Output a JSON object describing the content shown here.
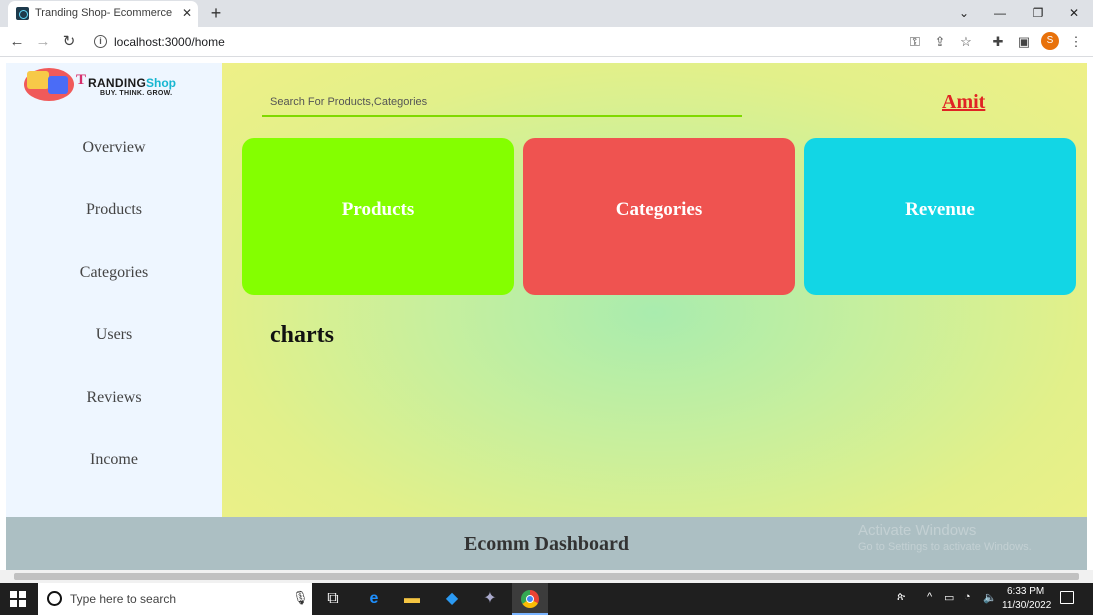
{
  "browser": {
    "tab_title": "Tranding Shop- Ecommerce Dash",
    "tab_close": "✕",
    "new_tab": "+",
    "url": "localhost:3000/home",
    "profile_initial": "S"
  },
  "logo": {
    "letter": "T",
    "name": "RANDING",
    "shop": "Shop",
    "tagline": "BUY. THINK. GROW."
  },
  "sidebar": {
    "items": [
      {
        "label": "Overview"
      },
      {
        "label": "Products"
      },
      {
        "label": "Categories"
      },
      {
        "label": "Users"
      },
      {
        "label": "Reviews"
      },
      {
        "label": "Income"
      }
    ]
  },
  "header": {
    "search_placeholder": "Search For Products,Categories",
    "user_name": "Amit"
  },
  "cards": [
    {
      "label": "Products",
      "color": "#84ff00"
    },
    {
      "label": "Categories",
      "color": "#ef5350"
    },
    {
      "label": "Revenue",
      "color": "#12d6e5"
    }
  ],
  "charts_title": "charts",
  "footer": {
    "title": "Ecomm Dashboard",
    "activate_line1": "Activate Windows",
    "activate_line2": "Go to Settings to activate Windows."
  },
  "taskbar": {
    "search_text": "Type here to search",
    "time": "6:33 PM",
    "date": "11/30/2022"
  }
}
